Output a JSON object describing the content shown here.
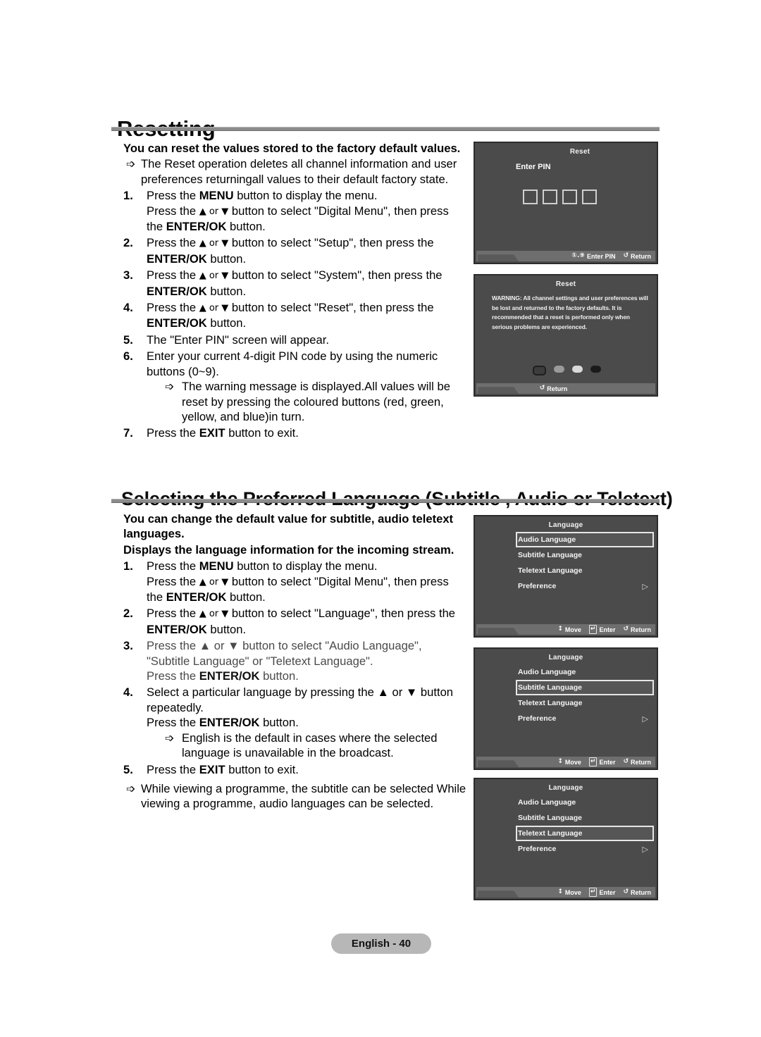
{
  "page": {
    "footer_badge": "English - 40"
  },
  "sections": [
    {
      "heading": "Resetting",
      "lead": "You can reset the values stored to the factory default values.",
      "intro_bullet": "The Reset operation deletes all channel information and user preferences returningall values to their default factory state.",
      "steps": [
        {
          "num": "1.",
          "line1_a": "Press the ",
          "line1_b": "MENU",
          "line1_c": " button to display the menu.",
          "line2_a": "Press the ",
          "line2_b": "▲ or ▼",
          "line2_c": " button to select \"Digital Menu\", then press the ",
          "line2_d": "ENTER/OK",
          "line2_e": " button."
        },
        {
          "num": "2.",
          "text_a": "Press the ",
          "text_b": "▲ or ▼",
          "text_c": " button to select \"Setup\", then press the ",
          "text_d": "ENTER/OK",
          "text_e": " button."
        },
        {
          "num": "3.",
          "text_a": "Press the ",
          "text_b": "▲ or ▼",
          "text_c": " button to select \"System\", then press the ",
          "text_d": "ENTER/OK",
          "text_e": " button."
        },
        {
          "num": "4.",
          "text_a": "Press the ",
          "text_b": "▲ or ▼",
          "text_c": " button to select \"Reset\", then press the ",
          "text_d": "ENTER/OK",
          "text_e": " button."
        },
        {
          "num": "5.",
          "text": "The \"Enter PIN\" screen will appear."
        },
        {
          "num": "6.",
          "text": "Enter your current 4-digit PIN code by using the numeric buttons (0~9).",
          "sub_bullet": "The warning message is displayed.All values will be reset by pressing the coloured buttons (red, green, yellow, and blue)in turn."
        },
        {
          "num": "7.",
          "text_a": "Press the ",
          "text_b": "EXIT",
          "text_c": " button to exit."
        }
      ]
    },
    {
      "heading": "Selecting the Preferred Language (Subtitle , Audio or Teletext)",
      "lead": "You can change the default value for subtitle, audio teletext languages.",
      "lead2": "Displays the language information for the incoming stream.",
      "steps": [
        {
          "num": "1.",
          "line1_a": "Press the ",
          "line1_b": "MENU",
          "line1_c": " button to display the menu.",
          "line2_a": "Press the ",
          "line2_b": "▲ or ▼",
          "line2_c": " button to select \"Digital Menu\", then press the ",
          "line2_d": "ENTER/OK",
          "line2_e": " button."
        },
        {
          "num": "2.",
          "text_a": "Press the ",
          "text_b": "▲ or ▼",
          "text_c": " button to select \"Language\", then press the ",
          "text_d": "ENTER/OK",
          "text_e": " button."
        },
        {
          "num": "3.",
          "line1": "Press the ▲ or ▼ button to select \"Audio Language\",",
          "line2": "\"Subtitle Language\" or \"Teletext Language\".",
          "line3_a": "Press the ",
          "line3_b": "ENTER/OK",
          "line3_c": " button."
        },
        {
          "num": "4.",
          "text": "Select a particular language by pressing the ▲ or ▼ button repeatedly.",
          "line2_a": "Press the ",
          "line2_b": "ENTER/OK",
          "line2_c": " button.",
          "sub_bullet": "English is the default in cases where the selected language is unavailable in the broadcast."
        },
        {
          "num": "5.",
          "text_a": "Press the ",
          "text_b": "EXIT",
          "text_c": " button to exit."
        }
      ],
      "closing_bullet": "While viewing a programme, the subtitle can be selected While viewing a programme, audio languages can be selected."
    }
  ],
  "osd_screens": [
    {
      "id": "reset-pin",
      "title": "Reset",
      "enter_pin_label": "Enter PIN",
      "pin_cells": 4,
      "footer": [
        {
          "icon": "numeric-keypad-icon",
          "glyph": "①.⑨",
          "label": "Enter PIN"
        },
        {
          "icon": "return-arrow-icon",
          "glyph": "↺",
          "label": "Return"
        }
      ]
    },
    {
      "id": "reset-warning",
      "title": "Reset",
      "warning": "WARNING: All channel settings and user preferences will be lost and returned to the factory defaults. It is recommended that a reset is performed only when serious problems are experienced.",
      "colour_buttons": [
        {
          "name": "red-button",
          "shade": "#3c3c3c"
        },
        {
          "name": "green-button",
          "shade": "#9a9a9a"
        },
        {
          "name": "yellow-button",
          "shade": "#d9d9d9"
        },
        {
          "name": "blue-button",
          "shade": "#1a1a1a"
        }
      ],
      "footer": [
        {
          "icon": "return-arrow-icon",
          "glyph": "↺",
          "label": "Return"
        }
      ]
    },
    {
      "id": "language-audio",
      "title": "Language",
      "items": [
        {
          "label": "Audio Language",
          "selected": true,
          "chevron": false
        },
        {
          "label": "Subtitle Language",
          "selected": false,
          "chevron": false
        },
        {
          "label": "Teletext Language",
          "selected": false,
          "chevron": false
        },
        {
          "label": "Preference",
          "selected": false,
          "chevron": true
        }
      ],
      "footer": [
        {
          "icon": "move-updown-icon",
          "glyph": "↕",
          "label": "Move"
        },
        {
          "icon": "enter-key-icon",
          "glyph": "↵",
          "label": "Enter"
        },
        {
          "icon": "return-arrow-icon",
          "glyph": "↺",
          "label": "Return"
        }
      ]
    },
    {
      "id": "language-subtitle",
      "title": "Language",
      "items": [
        {
          "label": "Audio Language",
          "selected": false,
          "chevron": false
        },
        {
          "label": "Subtitle Language",
          "selected": true,
          "chevron": false
        },
        {
          "label": "Teletext Language",
          "selected": false,
          "chevron": false
        },
        {
          "label": "Preference",
          "selected": false,
          "chevron": true
        }
      ],
      "footer": [
        {
          "icon": "move-updown-icon",
          "glyph": "↕",
          "label": "Move"
        },
        {
          "icon": "enter-key-icon",
          "glyph": "↵",
          "label": "Enter"
        },
        {
          "icon": "return-arrow-icon",
          "glyph": "↺",
          "label": "Return"
        }
      ]
    },
    {
      "id": "language-teletext",
      "title": "Language",
      "items": [
        {
          "label": "Audio Language",
          "selected": false,
          "chevron": false
        },
        {
          "label": "Subtitle Language",
          "selected": false,
          "chevron": false
        },
        {
          "label": "Teletext Language",
          "selected": true,
          "chevron": false
        },
        {
          "label": "Preference",
          "selected": false,
          "chevron": true
        }
      ],
      "footer": [
        {
          "icon": "move-updown-icon",
          "glyph": "↕",
          "label": "Move"
        },
        {
          "icon": "enter-key-icon",
          "glyph": "↵",
          "label": "Enter"
        },
        {
          "icon": "return-arrow-icon",
          "glyph": "↺",
          "label": "Return"
        }
      ]
    }
  ]
}
